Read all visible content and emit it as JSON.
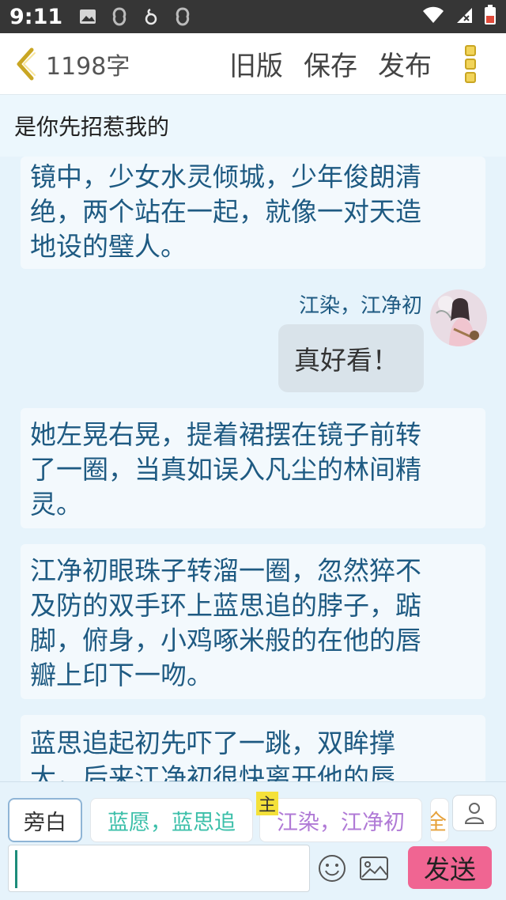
{
  "status_bar": {
    "time": "9:11"
  },
  "header": {
    "word_count": "1198字",
    "old_version": "旧版",
    "save": "保存",
    "publish": "发布"
  },
  "chapter": {
    "title": "是你先招惹我的"
  },
  "story": {
    "block1": [
      "镜中，少女水灵倾城，少年俊朗清",
      "绝，两个站在一起，就像一对天造",
      "地设的璧人。"
    ],
    "dialog": {
      "speaker": "江染，江净初",
      "text": "真好看！"
    },
    "block2": [
      "她左晃右晃，提着裙摆在镜子前转",
      "了一圈，当真如误入凡尘的林间精",
      "灵。"
    ],
    "block3": [
      "江净初眼珠子转溜一圈，忽然猝不",
      "及防的双手环上蓝思追的脖子，踮",
      "脚，俯身，小鸡啄米般的在他的唇",
      "瓣上印下一吻。"
    ],
    "block4": [
      "蓝思追起初先吓了一跳，双眸撑",
      "大，后来江净初很快离开他的唇"
    ]
  },
  "roles": {
    "narrator": "旁白",
    "role1": "蓝愿，蓝思追",
    "role2": "江染，江净初",
    "main_tag": "主",
    "role3_partial": "全"
  },
  "input": {
    "value": "",
    "send": "发送"
  },
  "colors": {
    "accent_pink": "#f06592",
    "story_text": "#1e5a82",
    "role1": "#3bbfa9",
    "role2": "#b07ad6",
    "main_tag": "#f4e13a"
  }
}
